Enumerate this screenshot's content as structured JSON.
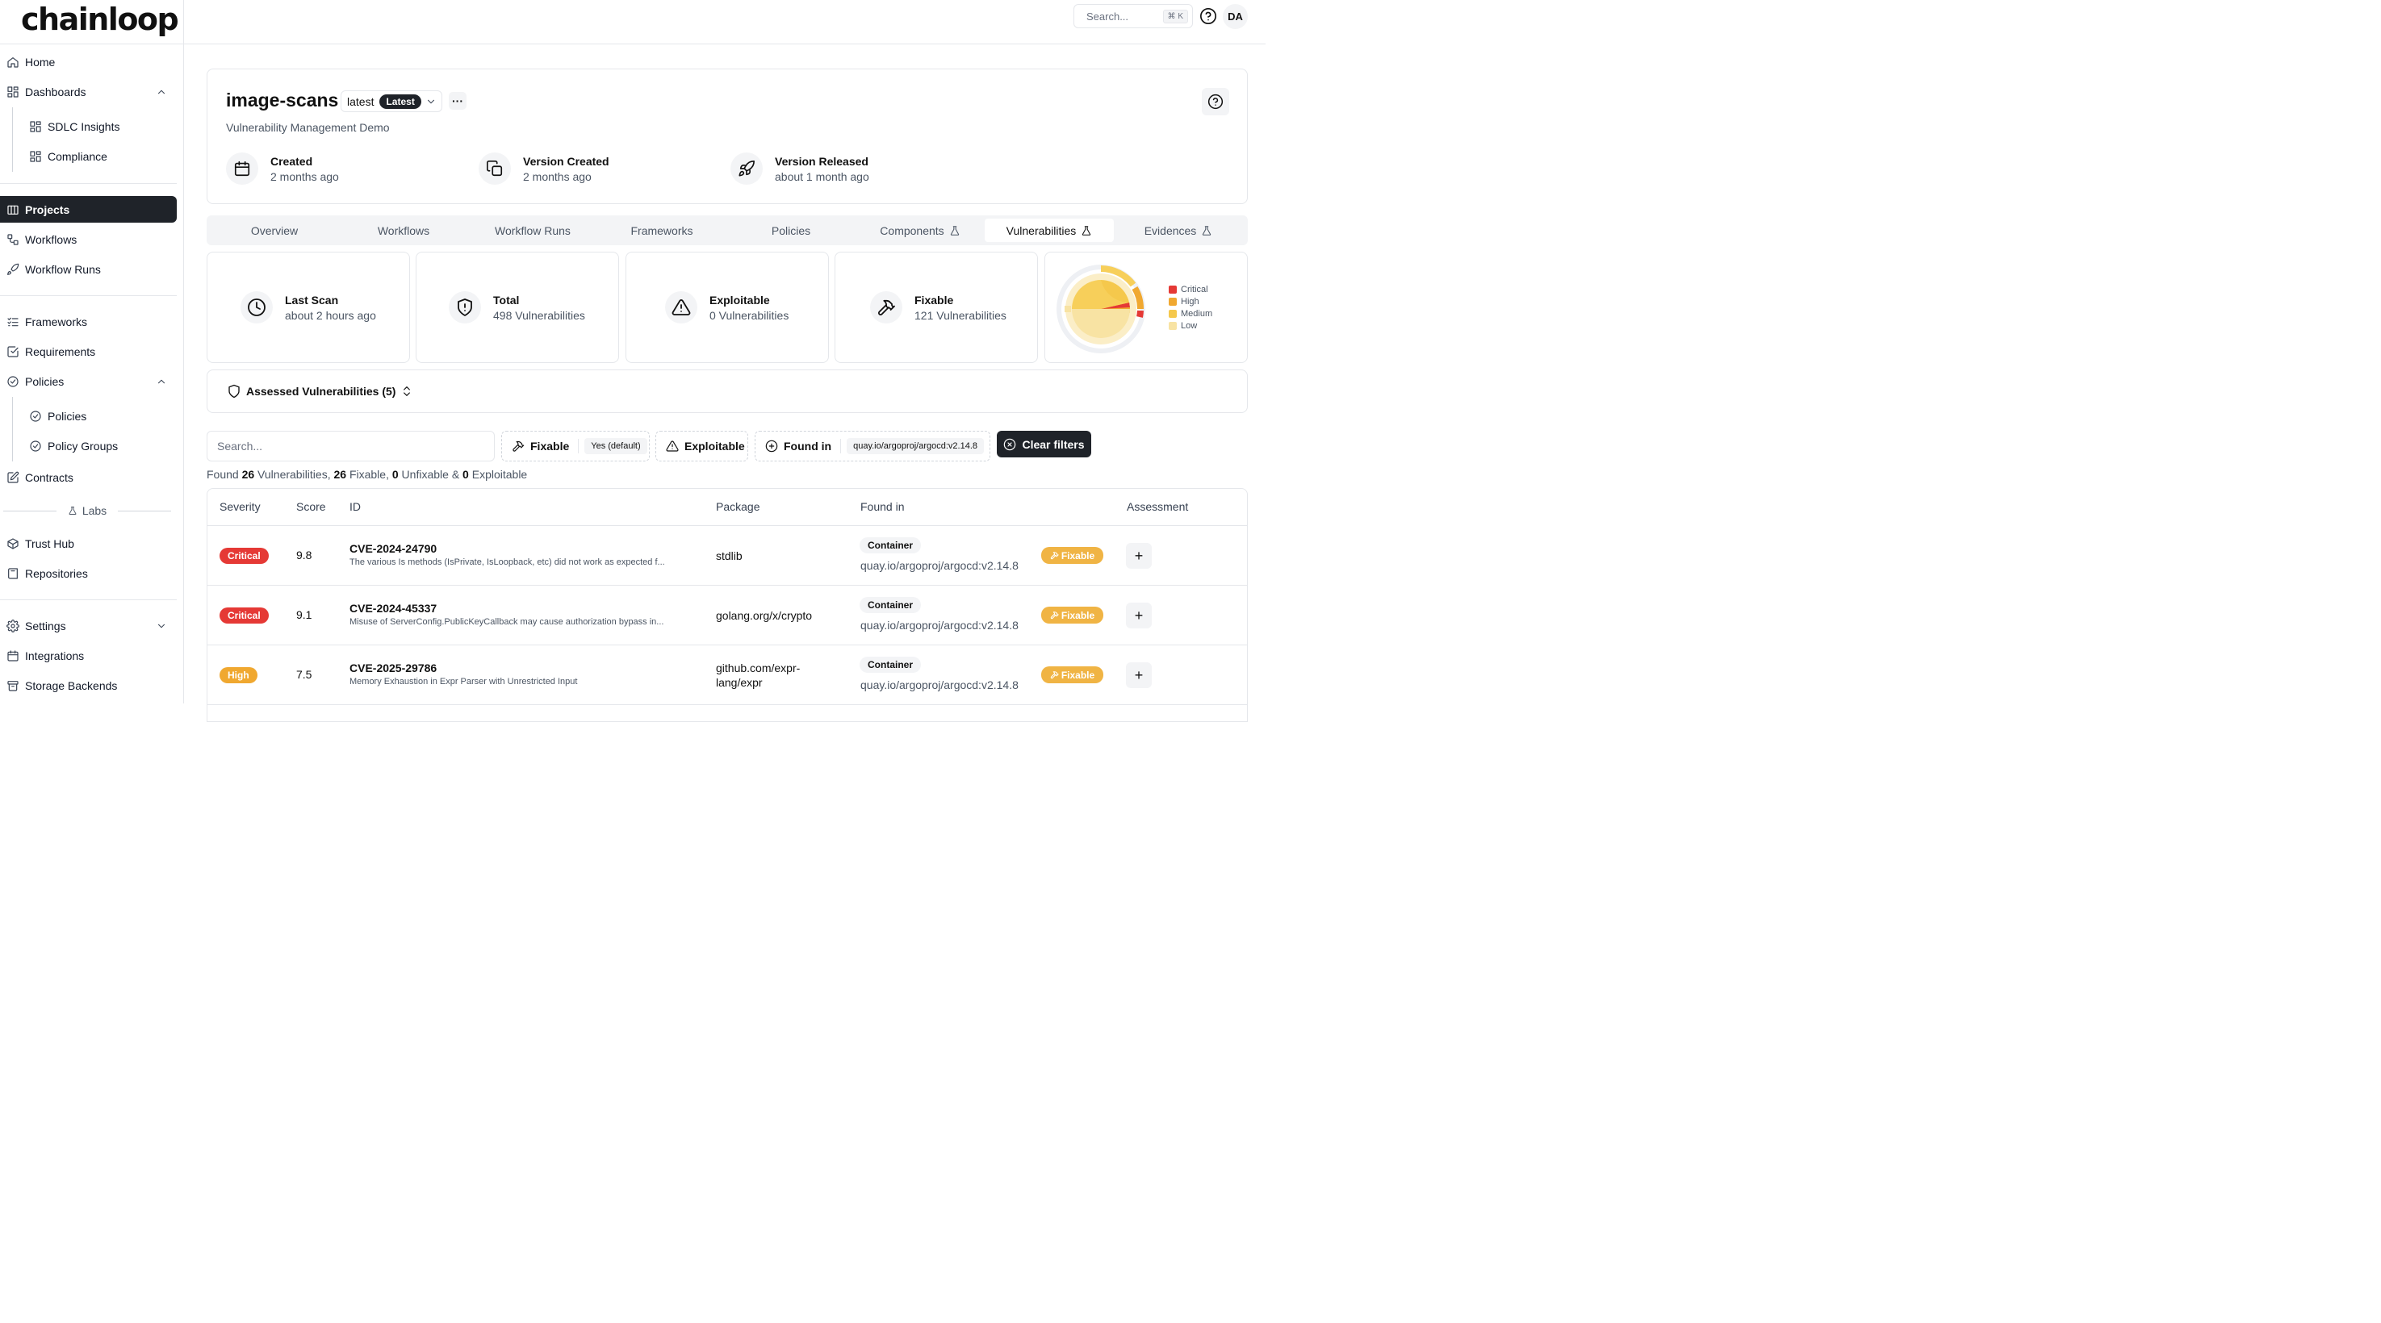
{
  "brand": {
    "logo_text": "chainloop"
  },
  "topbar": {
    "search_placeholder": "Search...",
    "search_shortcut": "⌘ K",
    "avatar_initials": "DA"
  },
  "sidebar": {
    "home": "Home",
    "dashboards": "Dashboards",
    "sdlc_insights": "SDLC Insights",
    "compliance": "Compliance",
    "projects": "Projects",
    "workflows": "Workflows",
    "workflow_runs": "Workflow Runs",
    "frameworks": "Frameworks",
    "requirements": "Requirements",
    "policies": "Policies",
    "policies_sub": "Policies",
    "policy_groups": "Policy Groups",
    "contracts": "Contracts",
    "labs": "Labs",
    "trust_hub": "Trust Hub",
    "repositories": "Repositories",
    "settings": "Settings",
    "integrations": "Integrations",
    "storage_backends": "Storage Backends"
  },
  "project": {
    "title": "image-scans",
    "version": "latest",
    "version_badge": "Latest",
    "description": "Vulnerability Management Demo",
    "meta": [
      {
        "title": "Created",
        "value": "2 months ago",
        "icon": "calendar-icon"
      },
      {
        "title": "Version Created",
        "value": "2 months ago",
        "icon": "copy-icon"
      },
      {
        "title": "Version Released",
        "value": "about 1 month ago",
        "icon": "rocket-icon"
      }
    ]
  },
  "tabs": [
    {
      "label": "Overview"
    },
    {
      "label": "Workflows"
    },
    {
      "label": "Workflow Runs"
    },
    {
      "label": "Frameworks"
    },
    {
      "label": "Policies"
    },
    {
      "label": "Components"
    },
    {
      "label": "Vulnerabilities"
    },
    {
      "label": "Evidences"
    }
  ],
  "active_tab": "Vulnerabilities",
  "stats": [
    {
      "title": "Last Scan",
      "value": "about 2 hours ago",
      "icon": "clock-icon"
    },
    {
      "title": "Total",
      "value": "498 Vulnerabilities",
      "icon": "shield-icon"
    },
    {
      "title": "Exploitable",
      "value": "0 Vulnerabilities",
      "icon": "warning-icon"
    },
    {
      "title": "Fixable",
      "value": "121 Vulnerabilities",
      "icon": "hammer-icon"
    }
  ],
  "severity_legend": [
    {
      "label": "Critical",
      "color": "#e53935"
    },
    {
      "label": "High",
      "color": "#f0a830"
    },
    {
      "label": "Medium",
      "color": "#f5c84c"
    },
    {
      "label": "Low",
      "color": "#f8e3a3"
    }
  ],
  "assessed": {
    "label": "Assessed Vulnerabilities (5)"
  },
  "filters": {
    "search_placeholder": "Search...",
    "fixable_label": "Fixable",
    "fixable_value": "Yes (default)",
    "exploitable_label": "Exploitable",
    "found_in_label": "Found in",
    "found_in_value": "quay.io/argoproj/argocd:v2.14.8",
    "clear_label": "Clear filters"
  },
  "summary": {
    "prefix": "Found ",
    "total": "26",
    "t1": " Vulnerabilities, ",
    "fixable": "26",
    "t2": " Fixable, ",
    "unfixable": "0",
    "t3": " Unfixable & ",
    "exploitable": "0",
    "t4": " Exploitable"
  },
  "table": {
    "columns": [
      "Severity",
      "Score",
      "ID",
      "Package",
      "Found in",
      "Assessment"
    ],
    "rows": [
      {
        "severity": "Critical",
        "severity_color": "#e53935",
        "score": "9.8",
        "id": "CVE-2024-24790",
        "description": "The various Is methods (IsPrivate, IsLoopback, etc) did not work as expected f...",
        "package": "stdlib",
        "found_type": "Container",
        "found_in": "quay.io/argoproj/argocd:v2.14.8",
        "fix_label": "Fixable"
      },
      {
        "severity": "Critical",
        "severity_color": "#e53935",
        "score": "9.1",
        "id": "CVE-2024-45337",
        "description": "Misuse of ServerConfig.PublicKeyCallback may cause authorization bypass in...",
        "package": "golang.org/x/crypto",
        "found_type": "Container",
        "found_in": "quay.io/argoproj/argocd:v2.14.8",
        "fix_label": "Fixable"
      },
      {
        "severity": "High",
        "severity_color": "#f0a830",
        "score": "7.5",
        "id": "CVE-2025-29786",
        "description": "Memory Exhaustion in Expr Parser with Unrestricted Input",
        "package": "github.com/expr-lang/expr",
        "found_type": "Container",
        "found_in": "quay.io/argoproj/argocd:v2.14.8",
        "fix_label": "Fixable"
      }
    ]
  }
}
